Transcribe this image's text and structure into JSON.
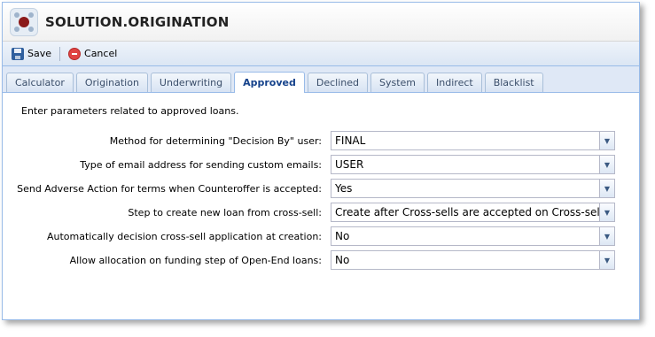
{
  "window": {
    "title": "SOLUTION.ORIGINATION"
  },
  "toolbar": {
    "save_label": "Save",
    "cancel_label": "Cancel"
  },
  "tabs": [
    {
      "label": "Calculator",
      "active": false
    },
    {
      "label": "Origination",
      "active": false
    },
    {
      "label": "Underwriting",
      "active": false
    },
    {
      "label": "Approved",
      "active": true
    },
    {
      "label": "Declined",
      "active": false
    },
    {
      "label": "System",
      "active": false
    },
    {
      "label": "Indirect",
      "active": false
    },
    {
      "label": "Blacklist",
      "active": false
    }
  ],
  "content": {
    "intro": "Enter parameters related to approved loans.",
    "fields": [
      {
        "label": "Method for determining \"Decision By\" user:",
        "value": "FINAL"
      },
      {
        "label": "Type of email address for sending custom emails:",
        "value": "USER"
      },
      {
        "label": "Send Adverse Action for terms when Counteroffer is accepted:",
        "value": "Yes"
      },
      {
        "label": "Step to create new loan from cross-sell:",
        "value": "Create after Cross-sells are accepted on Cross-sell scree"
      },
      {
        "label": "Automatically decision cross-sell application at creation:",
        "value": "No"
      },
      {
        "label": "Allow allocation on funding step of Open-End loans:",
        "value": "No"
      }
    ]
  },
  "icons": {
    "app_logo": "app-logo-icon",
    "save": "floppy-disk-icon",
    "cancel": "cancel-circle-icon",
    "dropdown": "chevron-down-icon"
  },
  "colors": {
    "border": "#99bbe8",
    "tab_bar": "#dfe8f6",
    "active_tab_text": "#15428b",
    "logo_accent": "#8b1a1a"
  }
}
